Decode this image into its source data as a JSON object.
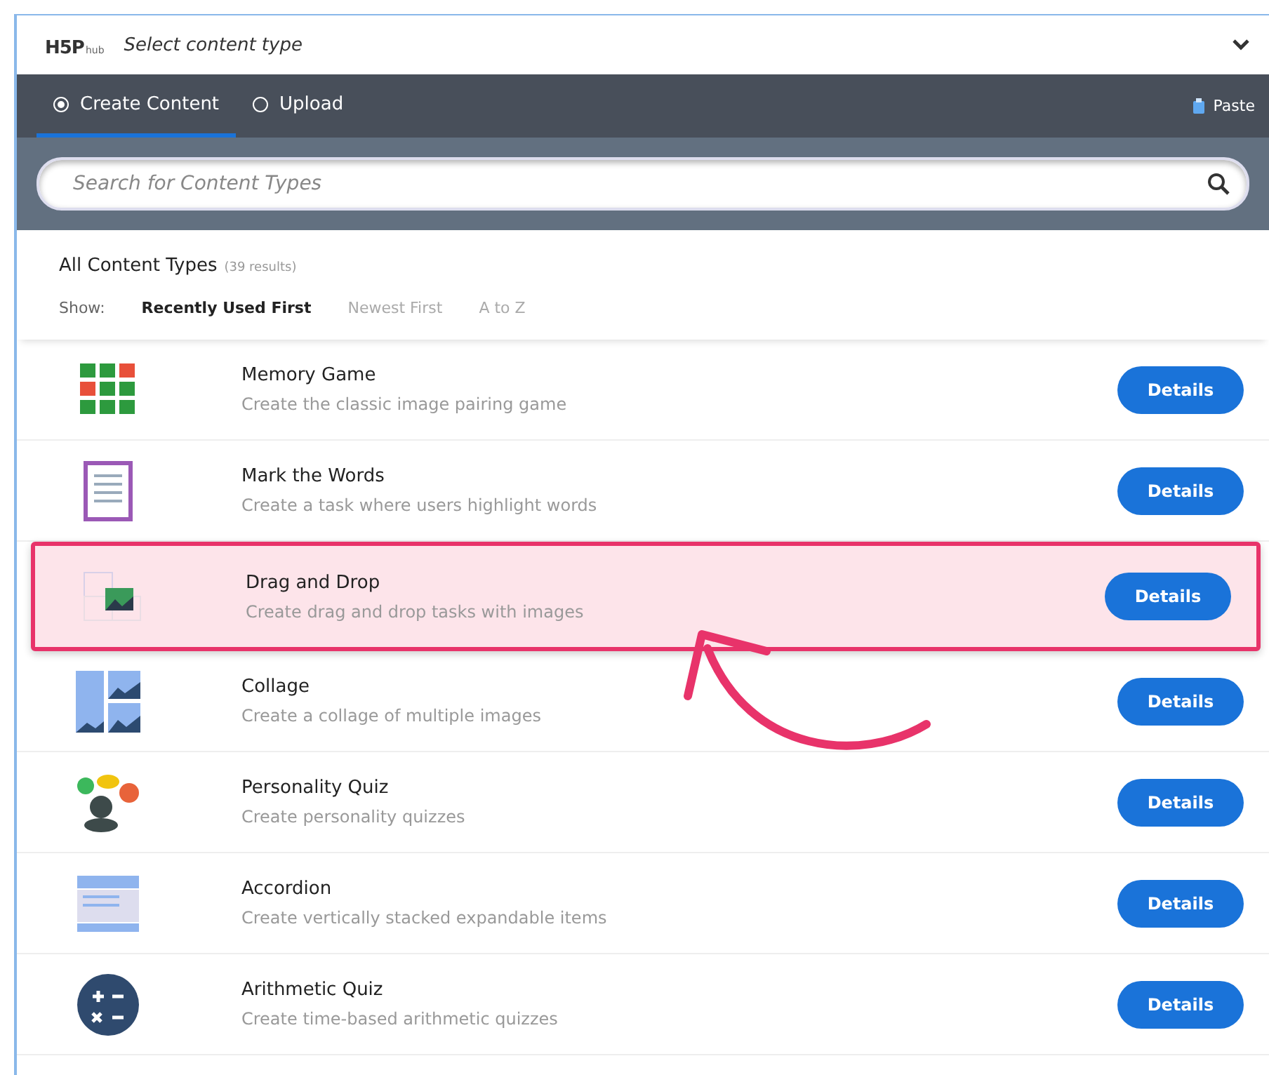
{
  "header": {
    "logo": "H5P",
    "logo_suffix": "hub",
    "title": "Select content type",
    "expanded": true
  },
  "tabs": [
    {
      "label": "Create Content",
      "selected": true
    },
    {
      "label": "Upload",
      "selected": false
    }
  ],
  "paste": {
    "label": "Paste"
  },
  "search": {
    "placeholder": "Search for Content Types"
  },
  "results": {
    "heading": "All Content Types",
    "count": "(39 results)"
  },
  "sort": {
    "label": "Show:",
    "options": [
      {
        "label": "Recently Used First",
        "selected": true
      },
      {
        "label": "Newest First",
        "selected": false
      },
      {
        "label": "A to Z",
        "selected": false
      }
    ]
  },
  "items": [
    {
      "kind": "memory",
      "title": "Memory Game",
      "description": "Create the classic image pairing game",
      "button": "Details",
      "highlighted": false
    },
    {
      "kind": "mark",
      "title": "Mark the Words",
      "description": "Create a task where users highlight words",
      "button": "Details",
      "highlighted": false
    },
    {
      "kind": "dragdrop",
      "title": "Drag and Drop",
      "description": "Create drag and drop tasks with images",
      "button": "Details",
      "highlighted": true
    },
    {
      "kind": "collage",
      "title": "Collage",
      "description": "Create a collage of multiple images",
      "button": "Details",
      "highlighted": false
    },
    {
      "kind": "personality",
      "title": "Personality Quiz",
      "description": "Create personality quizzes",
      "button": "Details",
      "highlighted": false
    },
    {
      "kind": "accordion",
      "title": "Accordion",
      "description": "Create vertically stacked expandable items",
      "button": "Details",
      "highlighted": false
    },
    {
      "kind": "arithmetic",
      "title": "Arithmetic Quiz",
      "description": "Create time-based arithmetic quizzes",
      "button": "Details",
      "highlighted": false
    }
  ]
}
